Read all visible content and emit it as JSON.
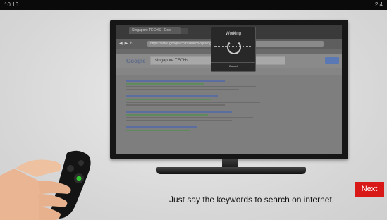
{
  "status": {
    "left": "10  16",
    "right": "2:4"
  },
  "browser": {
    "tab_title": "Singapore TECHS - Goo",
    "url": "https://www.google.com/search?q=singapore+techs",
    "search_query": "singapore TECHs"
  },
  "dialog": {
    "title": "Working",
    "cancel": "Cancel"
  },
  "footer": {
    "caption": "Just say the keywords to search on internet.",
    "next_label": "Next"
  },
  "colors": {
    "next_button": "#d91818",
    "background": "#d9d9d9",
    "tv_frame": "#161616"
  },
  "icons": {
    "mic_button": "mic-icon",
    "remote": "remote-control-icon"
  }
}
